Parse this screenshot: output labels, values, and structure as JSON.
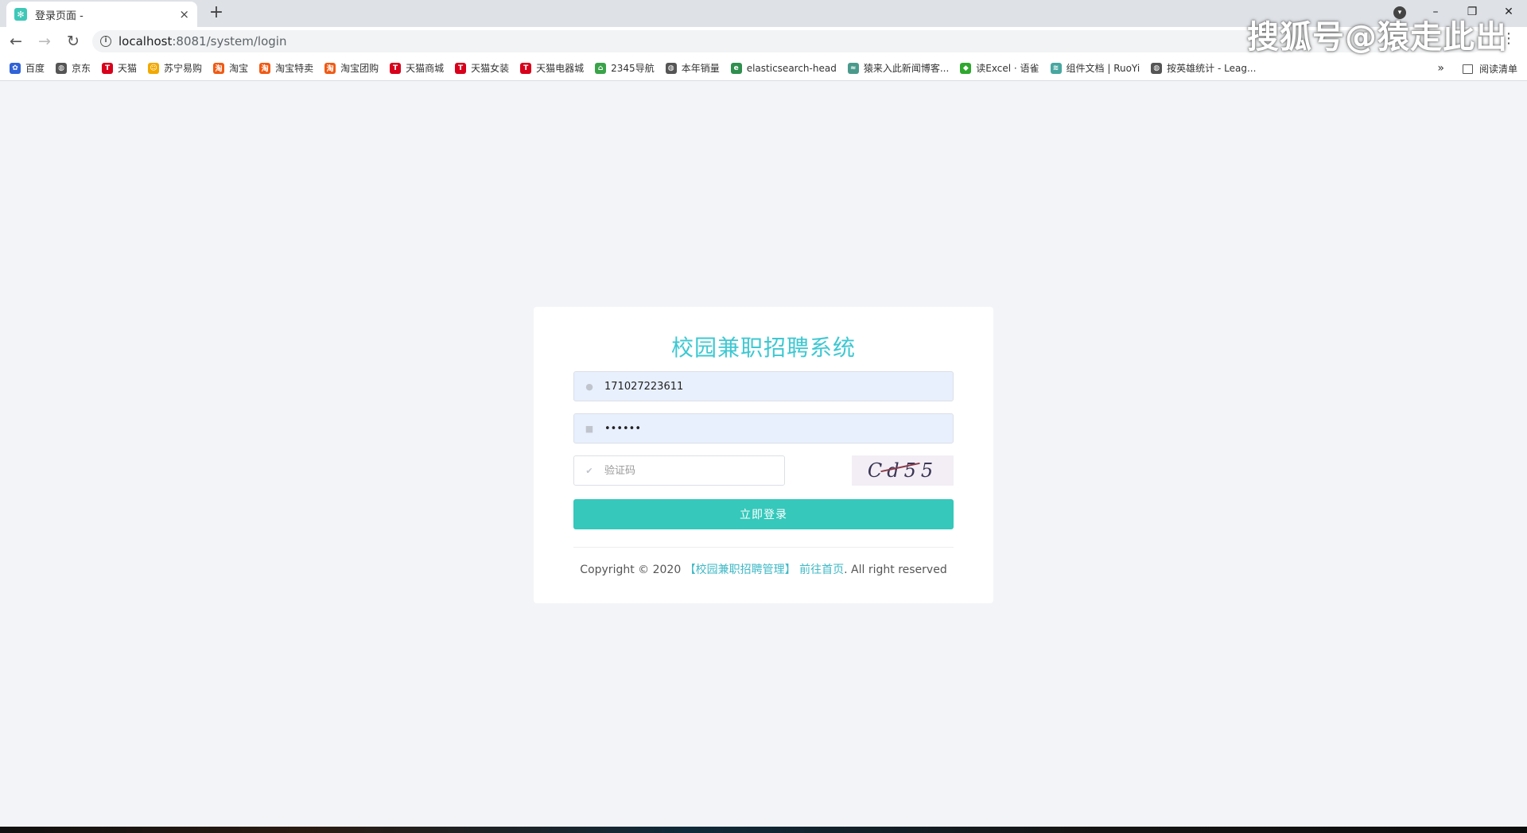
{
  "browser": {
    "tab_title": "登录页面 -",
    "tab_close": "×",
    "new_tab": "+",
    "url_host": "localhost",
    "url_path": ":8081/system/login",
    "win_minimize": "–",
    "win_restore": "❐",
    "win_close": "✕"
  },
  "bookmarks": [
    {
      "label": "百度",
      "icon": "paw-icon",
      "color": "#3062d8",
      "glyph": "✿"
    },
    {
      "label": "京东",
      "icon": "globe-icon",
      "color": "#555555",
      "glyph": "◍"
    },
    {
      "label": "天猫",
      "icon": "tmall-icon",
      "color": "#d8001b",
      "glyph": "T"
    },
    {
      "label": "苏宁易购",
      "icon": "suning-icon",
      "color": "#f2a900",
      "glyph": "☺"
    },
    {
      "label": "淘宝",
      "icon": "taobao-icon",
      "color": "#f05a14",
      "glyph": "淘"
    },
    {
      "label": "淘宝特卖",
      "icon": "taobao-icon",
      "color": "#f05a14",
      "glyph": "淘"
    },
    {
      "label": "淘宝团购",
      "icon": "taobao-icon",
      "color": "#f05a14",
      "glyph": "淘"
    },
    {
      "label": "天猫商城",
      "icon": "tmall-icon",
      "color": "#d8001b",
      "glyph": "T"
    },
    {
      "label": "天猫女装",
      "icon": "tmall-icon",
      "color": "#d8001b",
      "glyph": "T"
    },
    {
      "label": "天猫电器城",
      "icon": "tmall-icon",
      "color": "#d8001b",
      "glyph": "T"
    },
    {
      "label": "2345导航",
      "icon": "house-icon",
      "color": "#3aa34a",
      "glyph": "⌂"
    },
    {
      "label": "本年销量",
      "icon": "globe-icon",
      "color": "#555555",
      "glyph": "◍"
    },
    {
      "label": "elasticsearch-head",
      "icon": "elastic-icon",
      "color": "#2f8f4e",
      "glyph": "e"
    },
    {
      "label": "猿来入此新闻博客...",
      "icon": "news-icon",
      "color": "#4a9a8c",
      "glyph": "≈"
    },
    {
      "label": "读Excel · 语雀",
      "icon": "yuque-icon",
      "color": "#2ea82e",
      "glyph": "◆"
    },
    {
      "label": "组件文档 | RuoYi",
      "icon": "ruoyi-icon",
      "color": "#47a7a0",
      "glyph": "≋"
    },
    {
      "label": "按英雄统计 - Leag...",
      "icon": "globe-icon",
      "color": "#555555",
      "glyph": "◍"
    }
  ],
  "bookmarks_more": "»",
  "reading_list": "阅读清单",
  "watermark": "搜狐号@猿走此出",
  "login": {
    "title": "校园兼职招聘系统",
    "username_value": "171027223611",
    "password_value": "••••••",
    "captcha_placeholder": "验证码",
    "captcha_text": "Cd55",
    "submit_label": "立即登录",
    "footer_prefix": "Copyright © 2020 ",
    "footer_link1": "【校园兼职招聘管理】",
    "footer_link2": "前往首页",
    "footer_suffix": ". All right reserved"
  }
}
